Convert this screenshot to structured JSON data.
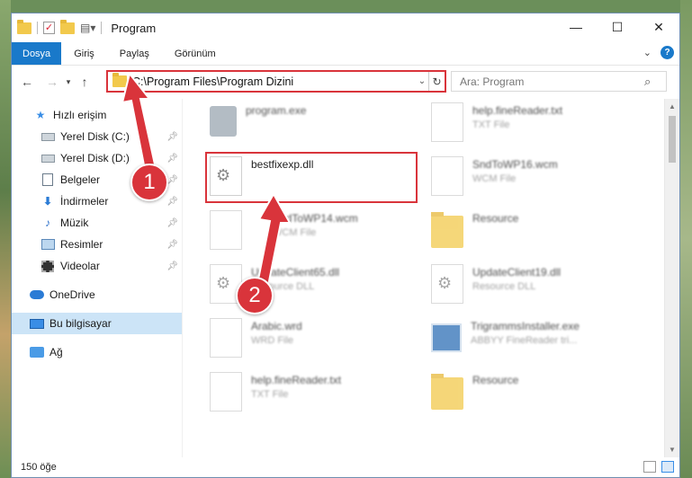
{
  "window": {
    "title": "Program"
  },
  "ribbon": {
    "file_tab": "Dosya",
    "tabs": [
      "Giriş",
      "Paylaş",
      "Görünüm"
    ],
    "help": "?"
  },
  "nav": {
    "address": "C:\\Program Files\\Program Dizini",
    "search_placeholder": "Ara: Program"
  },
  "sidebar": {
    "quick_access": "Hızlı erişim",
    "items": [
      {
        "label": "Yerel Disk (C:)",
        "icon": "drive-icon",
        "pinned": true
      },
      {
        "label": "Yerel Disk (D:)",
        "icon": "drive-icon",
        "pinned": true
      },
      {
        "label": "Belgeler",
        "icon": "documents-icon",
        "pinned": true
      },
      {
        "label": "İndirmeler",
        "icon": "downloads-icon",
        "pinned": true
      },
      {
        "label": "Müzik",
        "icon": "music-icon",
        "pinned": true
      },
      {
        "label": "Resimler",
        "icon": "pictures-icon",
        "pinned": true
      },
      {
        "label": "Videolar",
        "icon": "videos-icon",
        "pinned": true
      }
    ],
    "onedrive": "OneDrive",
    "this_pc": "Bu bilgisayar",
    "network": "Ağ"
  },
  "files": [
    {
      "name": "program.exe",
      "type": "",
      "icon": "program-icon"
    },
    {
      "name": "help.fineReader.txt",
      "type": "TXT File",
      "icon": "txt-file-icon"
    },
    {
      "name": "bestfixexp.dll",
      "type": "",
      "icon": "dll-gear-icon"
    },
    {
      "name": "SndToWP16.wcm",
      "type": "WCM File",
      "icon": "txt-file-icon"
    },
    {
      "name": "SndToWP14.wcm",
      "type": "WCM File",
      "icon": "txt-file-icon"
    },
    {
      "name": "Resource",
      "type": "",
      "icon": "folder-icon"
    },
    {
      "name": "UpdateClient65.dll",
      "type": "Resource DLL",
      "icon": "dll-gear-icon"
    },
    {
      "name": "UpdateClient19.dll",
      "type": "Resource DLL",
      "icon": "dll-gear-icon"
    },
    {
      "name": "Arabic.wrd",
      "type": "WRD File",
      "icon": "txt-file-icon"
    },
    {
      "name": "TrigrammsInstaller.exe",
      "type": "ABBYY FineReader tri...",
      "icon": "exe-icon"
    },
    {
      "name": "help.fineReader.txt",
      "type": "TXT File",
      "icon": "txt-file-icon"
    },
    {
      "name": "Resource",
      "type": "",
      "icon": "folder-icon"
    }
  ],
  "status": {
    "count": "150 öğe"
  },
  "annotations": {
    "step1": "1",
    "step2": "2"
  },
  "colors": {
    "accent": "#1979ca",
    "highlight": "#d9343b",
    "selected": "#cce4f7"
  }
}
